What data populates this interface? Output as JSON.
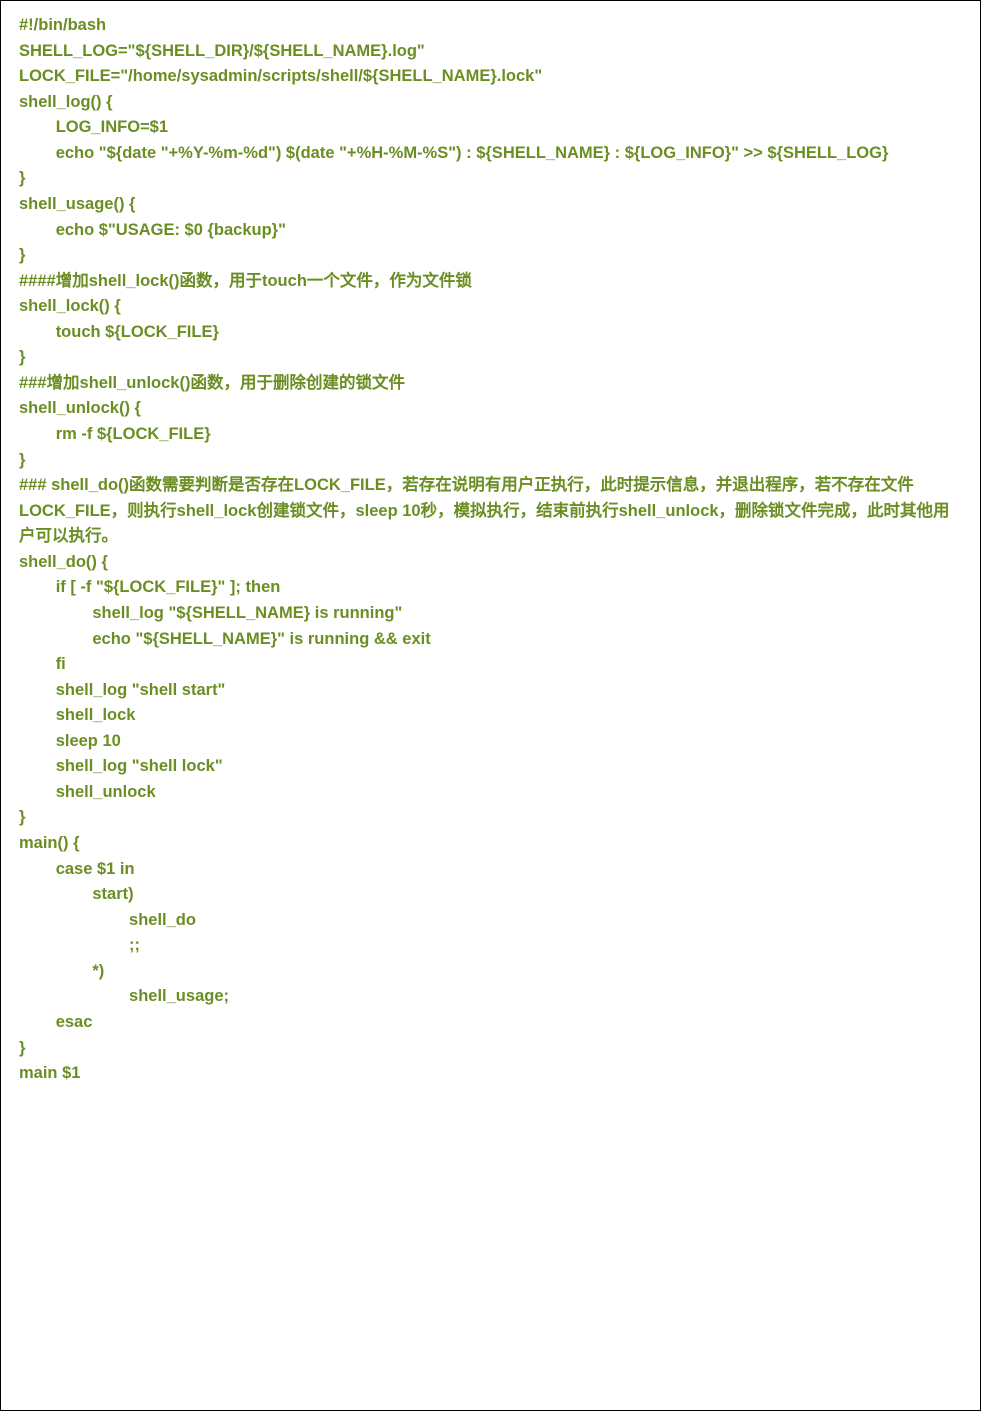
{
  "code_lines": [
    "#!/bin/bash",
    "SHELL_LOG=\"${SHELL_DIR}/${SHELL_NAME}.log\"",
    "LOCK_FILE=\"/home/sysadmin/scripts/shell/${SHELL_NAME}.lock\"",
    "shell_log() {",
    "        LOG_INFO=$1",
    "        echo \"${date \"+%Y-%m-%d\") $(date \"+%H-%M-%S\") : ${SHELL_NAME} : ${LOG_INFO}\" >> ${SHELL_LOG}",
    "}",
    "shell_usage() {",
    "        echo $\"USAGE: $0 {backup}\"",
    "}",
    "####增加shell_lock()函数，用于touch一个文件，作为文件锁",
    "shell_lock() {",
    "        touch ${LOCK_FILE}",
    "}",
    "###增加shell_unlock()函数，用于删除创建的锁文件",
    "shell_unlock() {",
    "        rm -f ${LOCK_FILE}",
    "}",
    "### shell_do()函数需要判断是否存在LOCK_FILE，若存在说明有用户正执行，此时提示信息，并退出程序，若不存在文件LOCK_FILE，则执行shell_lock创建锁文件，sleep 10秒，模拟执行，结束前执行shell_unlock，删除锁文件完成，此时其他用户可以执行。",
    "shell_do() {",
    "        if [ -f \"${LOCK_FILE}\" ]; then",
    "                shell_log \"${SHELL_NAME} is running\"",
    "                echo \"${SHELL_NAME}\" is running && exit",
    "        fi",
    "        shell_log \"shell start\"",
    "        shell_lock",
    "        sleep 10",
    "        shell_log \"shell lock\"",
    "        shell_unlock",
    "}",
    "main() {",
    "        case $1 in",
    "                start)",
    "                        shell_do",
    "                        ;;",
    "                *)",
    "                        shell_usage;",
    "        esac",
    "}",
    "main $1"
  ]
}
